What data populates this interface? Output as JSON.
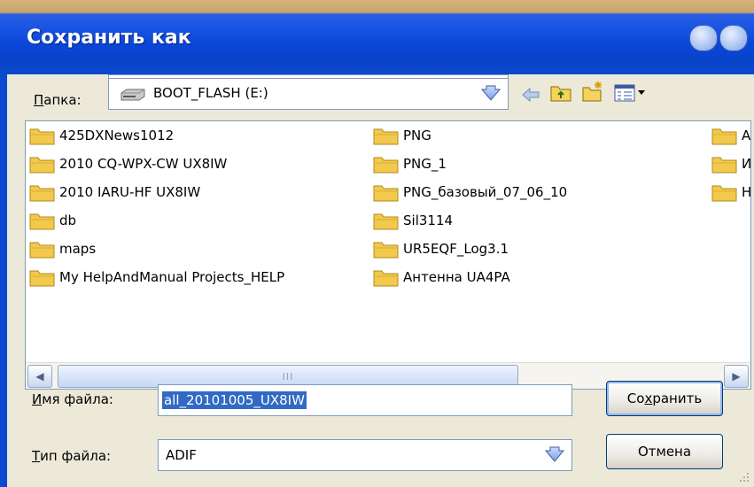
{
  "window": {
    "title": "Сохранить как"
  },
  "location": {
    "label": "Папка:",
    "label_access_key": "П",
    "label_rest": "апка:",
    "value": "BOOT_FLASH (E:)"
  },
  "files": [
    {
      "name": "425DXNews1012"
    },
    {
      "name": "2010 CQ-WPX-CW UX8IW"
    },
    {
      "name": "2010 IARU-HF UX8IW"
    },
    {
      "name": "db"
    },
    {
      "name": "maps"
    },
    {
      "name": "My HelpAndManual Projects_HELP"
    },
    {
      "name": "PNG"
    },
    {
      "name": "PNG_1"
    },
    {
      "name": "PNG_базовый_07_06_10"
    },
    {
      "name": "Sil3114"
    },
    {
      "name": "UR5EQF_Log3.1"
    },
    {
      "name": "Антенна UA4PA"
    },
    {
      "name": "А"
    },
    {
      "name": "И"
    },
    {
      "name": "Н"
    }
  ],
  "filename": {
    "label_access_key": "И",
    "label_rest": "мя файла:",
    "value": "all_20101005_UX8IW"
  },
  "filetype": {
    "label_access_key": "Т",
    "label_rest": "ип файла:",
    "value": "ADIF"
  },
  "buttons": {
    "save_pre": "Со",
    "save_key": "х",
    "save_post": "ранить",
    "cancel": "Отмена"
  },
  "scrollbar": {
    "thumb_grip": "III"
  },
  "colors": {
    "titlebar": "#0a46d8",
    "selection": "#316ac5",
    "folder": "#f5c542"
  }
}
